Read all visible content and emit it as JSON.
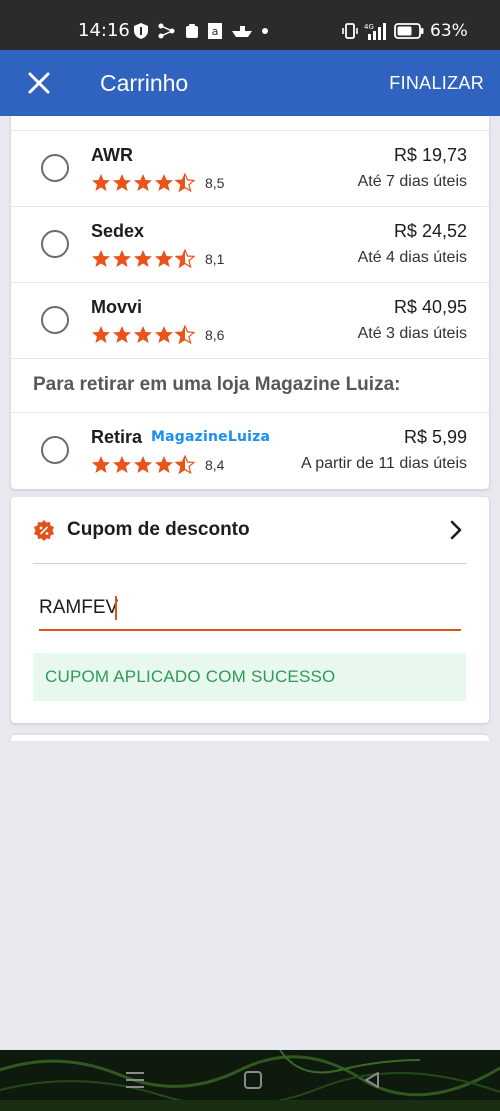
{
  "status_bar": {
    "time": "14:16",
    "battery": "63%",
    "icons": [
      "shield-icon",
      "share-icon",
      "clipboard-icon",
      "amazon-icon",
      "boat-icon",
      "dot-icon",
      "vibrate-icon",
      "signal-4g-icon",
      "battery-icon"
    ]
  },
  "app_bar": {
    "title": "Carrinho",
    "action": "FINALIZAR"
  },
  "shipping": {
    "options": [
      {
        "name": "AWR",
        "rating": "8,5",
        "price": "R$ 19,73",
        "eta": "Até 7 dias úteis"
      },
      {
        "name": "Sedex",
        "rating": "8,1",
        "price": "R$ 24,52",
        "eta": "Até 4 dias úteis"
      },
      {
        "name": "Movvi",
        "rating": "8,6",
        "price": "R$ 40,95",
        "eta": "Até 3 dias úteis"
      }
    ],
    "store_header": "Para retirar em uma loja Magazine Luiza:",
    "store_option": {
      "name": "Retira",
      "brand": "MagazineLuiza",
      "rating": "8,4",
      "price": "R$ 5,99",
      "eta": "A partir de 11 dias úteis"
    }
  },
  "coupon": {
    "title": "Cupom de desconto",
    "code": "RAMFEV",
    "status": "CUPOM APLICADO COM SUCESSO"
  },
  "colors": {
    "app_bar": "#2f63bf",
    "star": "#e8541c",
    "success_text": "#2e9a58",
    "success_bg": "#e8f8ee",
    "magalu_blue": "#1a8ff0"
  }
}
